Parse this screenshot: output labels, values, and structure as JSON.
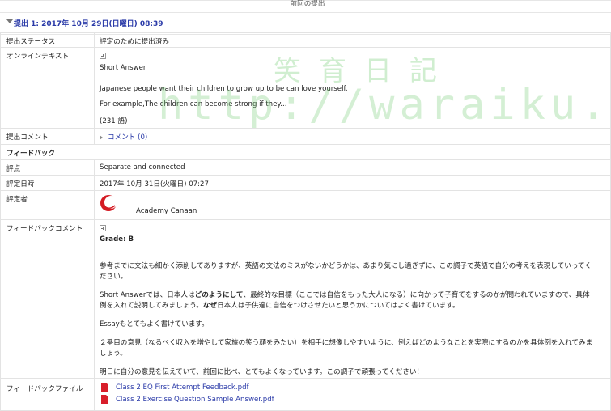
{
  "section_title": "前回の提出",
  "attempt": {
    "title": "提出 1: 2017年 10月 29日(日曜日) 08:39"
  },
  "rows": {
    "status": {
      "label": "提出ステータス",
      "value": "評定のために提出済み"
    },
    "online_text": {
      "label": "オンラインテキスト",
      "heading": "Short Answer",
      "line1": "Japanese people want their children to grow up to be can love yourself.",
      "line2": "For example,The children can become strong if they...",
      "word_count": "(231 語)"
    },
    "submission_comment": {
      "label": "提出コメント",
      "link": "コメント (0)"
    },
    "feedback_heading": "フィードバック",
    "grade": {
      "label": "評点",
      "value": "Separate and connected"
    },
    "graded_on": {
      "label": "評定日時",
      "value": "2017年 10月 31日(火曜日) 07:27"
    },
    "grader": {
      "label": "評定者",
      "name": "Academy Canaan"
    },
    "feedback_comment": {
      "label": "フィードバックコメント",
      "grade_line": "Grade: B",
      "p1": "参考までに文法も細かく添削してありますが、英語の文法のミスがないかどうかは、あまり気にし過ぎずに、この調子で英語で自分の考えを表現していってください。",
      "p2_a": "Short Answerでは、日本人は",
      "p2_b": "どのようにして",
      "p2_c": "、最終的な目標（ここでは自信をもった大人になる）に向かって子育てをするのかが問われていますので、具体例を入れて説明してみましょう。",
      "p2_d": "なぜ",
      "p2_e": "日本人は子供達に自信をつけさせたいと思うかについてはよく書けています。",
      "p3": "Essayもとてもよく書けています。",
      "p4": "２番目の意見（なるべく収入を増やして家族の笑う顔をみたい）を相手に想像しやすいように、例えばどのようなことを実際にするのかを具体例を入れてみましょう。",
      "p5": "明日に自分の意見を伝えていて、前回に比べ、とてもよくなっています。この調子で頑張ってください！"
    },
    "feedback_files": {
      "label": "フィードバックファイル",
      "files": [
        "Class 2 EQ First Attempt Feedback.pdf",
        "Class 2 Exercise Question Sample Answer.pdf"
      ]
    }
  },
  "watermark": {
    "cjk": "笑育日記",
    "url": "http://waraiku.net/"
  },
  "colors": {
    "link": "#2a3aa8",
    "pdf": "#d81e2a",
    "watermark": "#78cd78"
  }
}
